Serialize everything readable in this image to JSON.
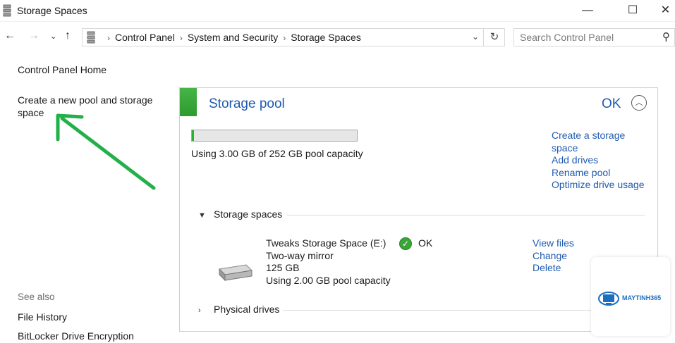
{
  "window": {
    "title": "Storage Spaces",
    "minimize_glyph": "—",
    "maximize_glyph": "☐",
    "close_glyph": "✕"
  },
  "address_bar": {
    "breadcrumbs": [
      "Control Panel",
      "System and Security",
      "Storage Spaces"
    ],
    "search_placeholder": "Search Control Panel"
  },
  "left_pane": {
    "home_link": "Control Panel Home",
    "create_pool_link": "Create a new pool and storage space",
    "see_also_heading": "See also",
    "see_also_links": [
      "File History",
      "BitLocker Drive Encryption"
    ]
  },
  "pool": {
    "title": "Storage pool",
    "status": "OK",
    "usage_fraction": 0.012,
    "usage_text": "Using 3.00 GB of 252 GB pool capacity",
    "actions": [
      "Create a storage space",
      "Add drives",
      "Rename pool",
      "Optimize drive usage"
    ],
    "storage_spaces_label": "Storage spaces",
    "physical_drives_label": "Physical drives",
    "space": {
      "name": "Tweaks Storage Space (E:)",
      "resiliency": "Two-way mirror",
      "size": "125 GB",
      "usage": "Using 2.00 GB pool capacity",
      "status": "OK",
      "actions": [
        "View files",
        "Change",
        "Delete"
      ]
    }
  },
  "watermark": {
    "brand": "MAYTINH365"
  },
  "colors": {
    "link": "#1e5bb0",
    "accent_green": "#2fb02f",
    "arrow_green": "#22b04a"
  }
}
